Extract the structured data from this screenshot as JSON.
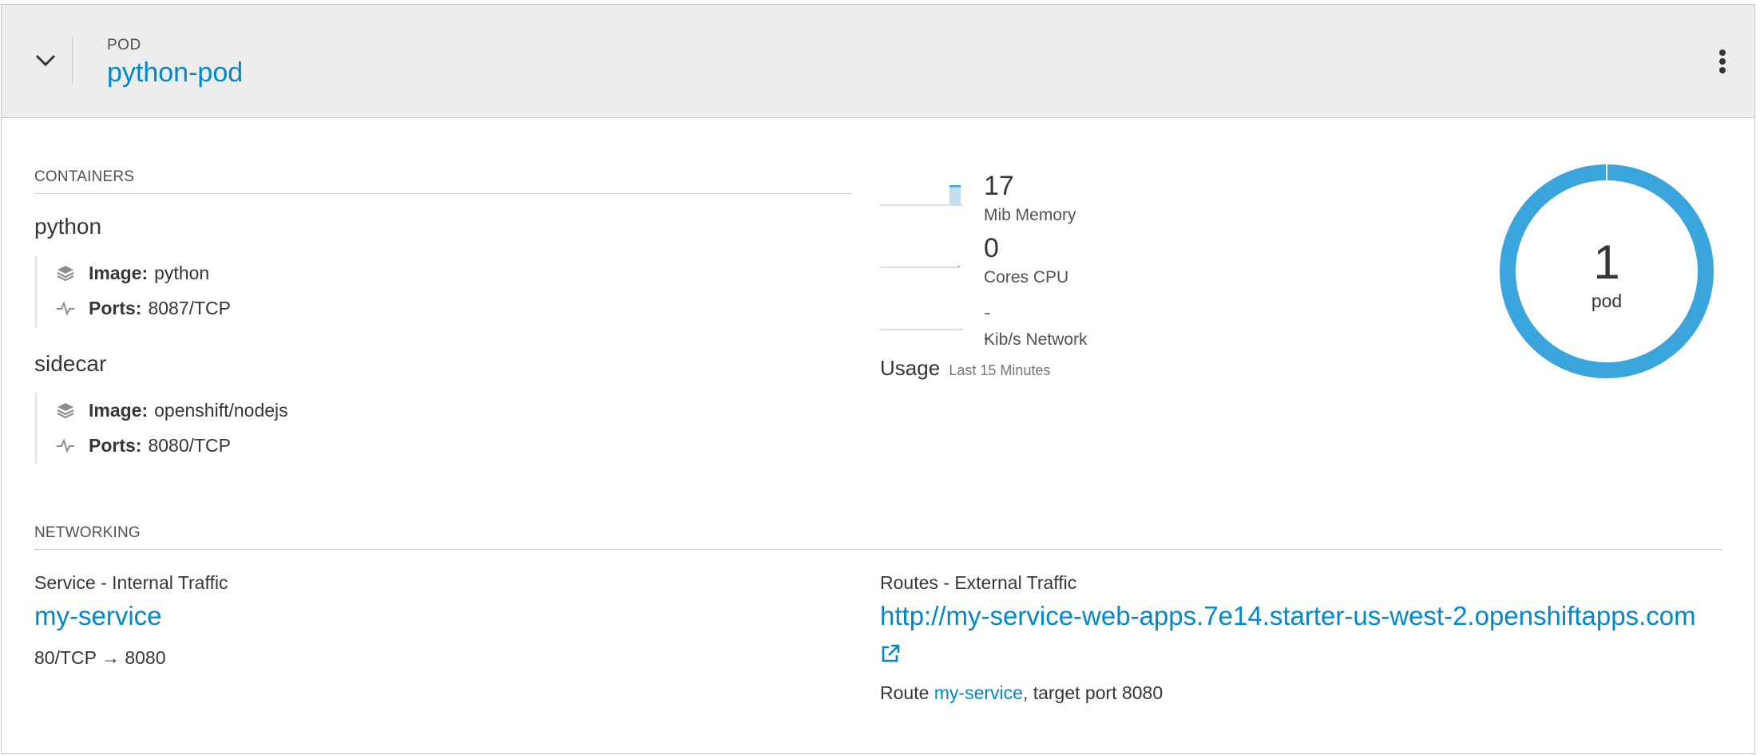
{
  "header": {
    "kind_label": "POD",
    "name": "python-pod"
  },
  "containers": {
    "title": "CONTAINERS",
    "items": [
      {
        "name": "python",
        "image_label": "Image:",
        "image": "python",
        "ports_label": "Ports:",
        "ports": "8087/TCP"
      },
      {
        "name": "sidecar",
        "image_label": "Image:",
        "image": "openshift/nodejs",
        "ports_label": "Ports:",
        "ports": "8080/TCP"
      }
    ]
  },
  "metrics": {
    "memory": {
      "value": "17",
      "unit": "Mib Memory"
    },
    "cpu": {
      "value": "0",
      "unit": "Cores CPU"
    },
    "network": {
      "value": "--",
      "unit": "Kib/s Network"
    },
    "usage_label": "Usage",
    "usage_range": "Last 15 Minutes"
  },
  "donut": {
    "count": "1",
    "label": "pod",
    "color": "#39a5dc"
  },
  "networking": {
    "title": "NETWORKING",
    "service": {
      "heading": "Service - Internal Traffic",
      "name": "my-service",
      "ports": "80/TCP → 8080"
    },
    "routes": {
      "heading": "Routes - External Traffic",
      "url": "http://my-service-web-apps.7e14.starter-us-west-2.openshiftapps.com",
      "route_prefix": "Route",
      "route_name": "my-service",
      "route_suffix": ", target port 8080"
    }
  },
  "icons": [
    "chevron-down-icon",
    "kebab-icon",
    "layers-icon",
    "pulse-icon",
    "external-link-icon"
  ],
  "colors": {
    "link": "#0088ce",
    "header_bg": "#ededed",
    "donut": "#39a5dc"
  }
}
